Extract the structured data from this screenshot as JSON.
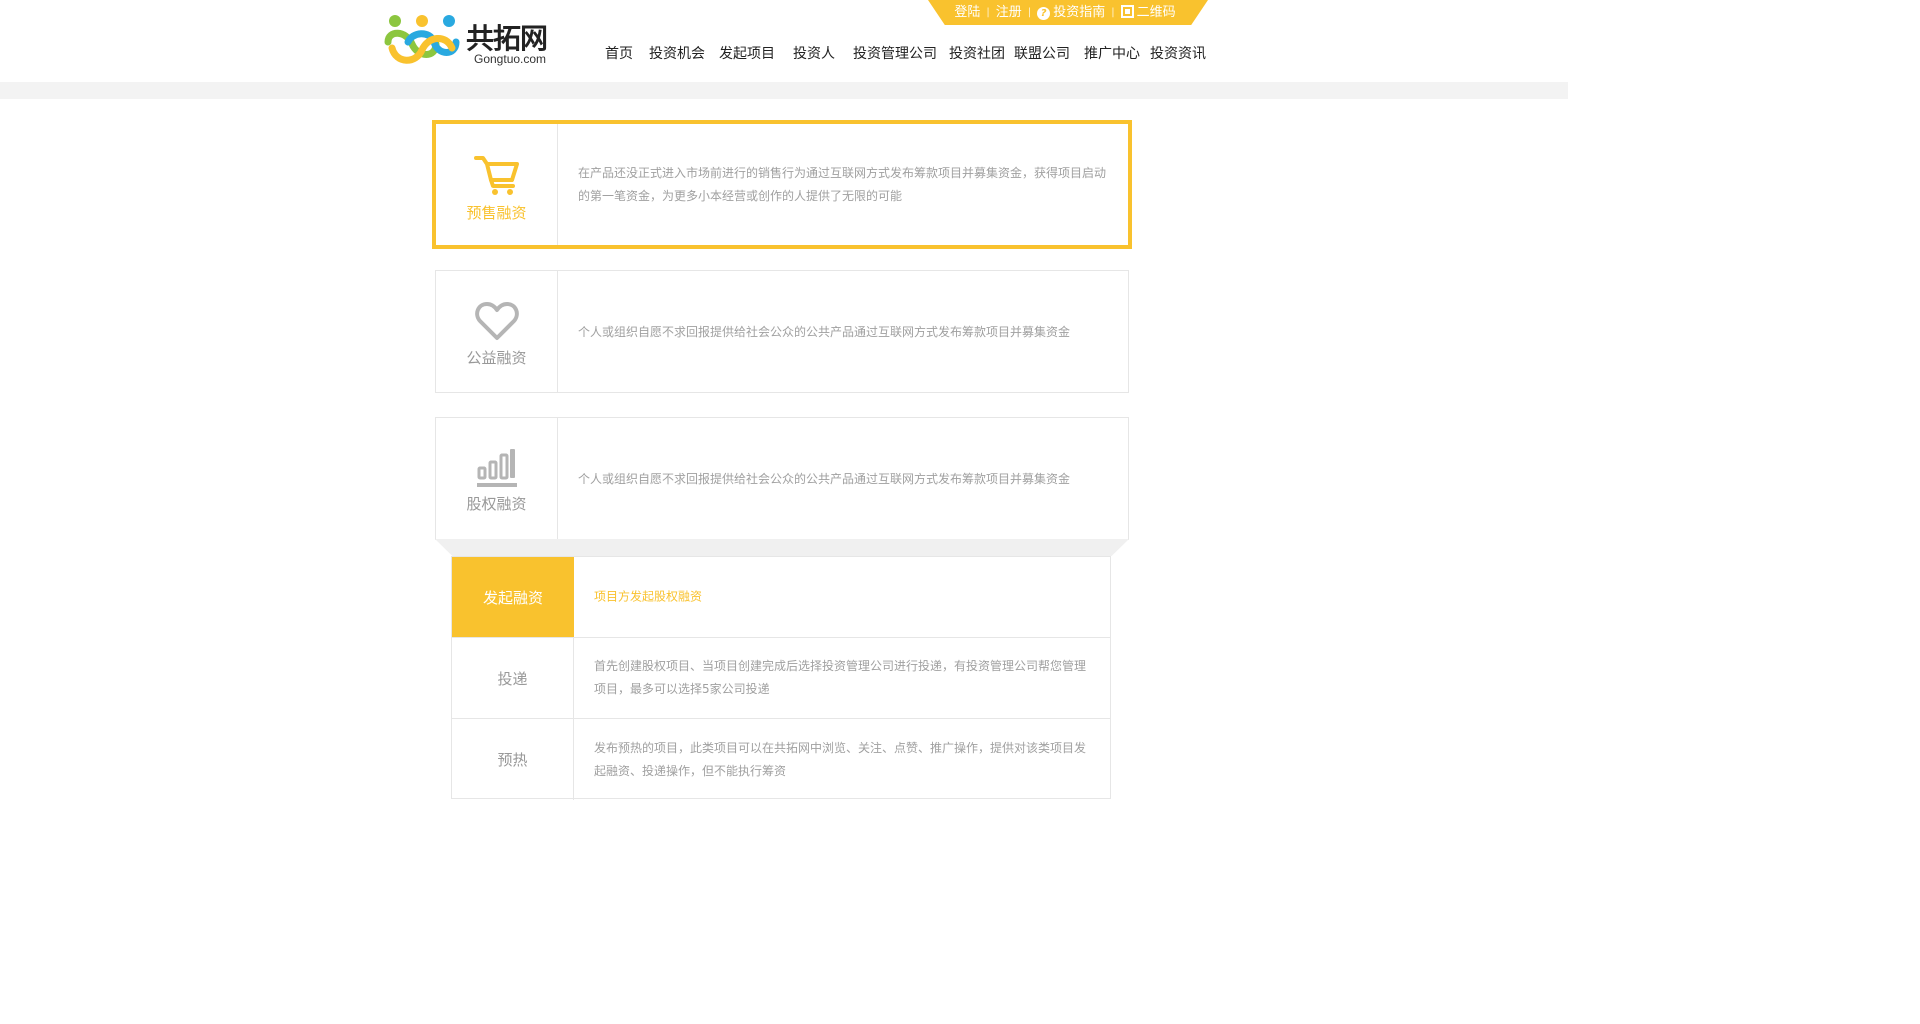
{
  "brand": {
    "name": "共拓网",
    "domain": "Gongtuo.com",
    "accent": "#f9c22e"
  },
  "topbar": {
    "login": "登陆",
    "register": "注册",
    "guide": "投资指南",
    "qrcode": "二维码"
  },
  "nav": [
    {
      "label": "首页"
    },
    {
      "label": "投资机会"
    },
    {
      "label": "发起项目"
    },
    {
      "label": "投资人"
    },
    {
      "label": "投资管理公司"
    },
    {
      "label": "投资社团"
    },
    {
      "label": "联盟公司"
    },
    {
      "label": "推广中心"
    },
    {
      "label": "投资资讯"
    }
  ],
  "cards": [
    {
      "label": "预售融资",
      "icon": "cart-icon",
      "desc": "在产品还没正式进入市场前进行的销售行为通过互联网方式发布筹款项目并募集资金，获得项目启动的第一笔资金，为更多小本经营或创作的人提供了无限的可能",
      "active": true
    },
    {
      "label": "公益融资",
      "icon": "heart-icon",
      "desc": "个人或组织自愿不求回报提供给社会公众的公共产品通过互联网方式发布筹款项目并募集资金",
      "active": false
    },
    {
      "label": "股权融资",
      "icon": "bar-chart-icon",
      "desc": "个人或组织自愿不求回报提供给社会公众的公共产品通过互联网方式发布筹款项目并募集资金",
      "active": false
    }
  ],
  "flow": [
    {
      "step": "发起融资",
      "desc": "项目方发起股权融资",
      "active": true
    },
    {
      "step": "投递",
      "desc": "首先创建股权项目、当项目创建完成后选择投资管理公司进行投递，有投资管理公司帮您管理项目，最多可以选择5家公司投递",
      "active": false
    },
    {
      "step": "预热",
      "desc": "发布预热的项目，此类项目可以在共拓网中浏览、关注、点赞、推广操作，提供对该类项目发起融资、投递操作，但不能执行筹资",
      "active": false
    }
  ]
}
